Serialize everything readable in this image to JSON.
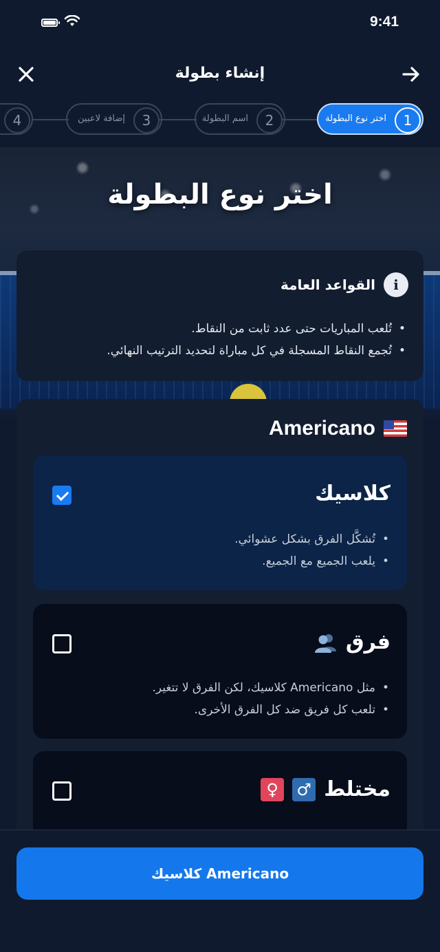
{
  "status_bar": {
    "time": "9:41"
  },
  "header": {
    "title": "إنشاء بطولة"
  },
  "stepper": {
    "steps": [
      {
        "number": "1",
        "label": "اختر نوع البطولة",
        "active": true
      },
      {
        "number": "2",
        "label": "اسم البطولة",
        "active": false
      },
      {
        "number": "3",
        "label": "إضافة لاعبين",
        "active": false
      },
      {
        "number": "4",
        "label": "",
        "active": false
      }
    ]
  },
  "page": {
    "title": "اختر نوع البطولة"
  },
  "rules": {
    "title": "القواعد العامة",
    "icon": "info-icon",
    "items": [
      "تُلعب المباريات حتى عدد ثابت من النقاط.",
      "تُجمع النقاط المسجلة في كل مباراة لتحديد الترتيب النهائي."
    ]
  },
  "americano": {
    "title": "Americano",
    "flag": "us-flag-icon",
    "options": [
      {
        "title": "كلاسيك",
        "checked": true,
        "items": [
          "تُشكَّل الفرق بشكل عشوائي.",
          "يلعب الجميع مع الجميع."
        ]
      },
      {
        "title": "فرق",
        "icon": "people-icon",
        "checked": false,
        "items": [
          "مثل Americano كلاسيك، لكن الفرق لا تتغير.",
          "تلعب كل فريق ضد كل الفرق الأخرى."
        ]
      },
      {
        "title": "مختلط",
        "icons": [
          "♂",
          "♀"
        ],
        "checked": false
      }
    ]
  },
  "cta": {
    "label": "Americano كلاسيك"
  },
  "colors": {
    "accent": "#1a7bf0",
    "background": "#0f1a2e",
    "card": "#141e31",
    "selected": "#0b2448"
  }
}
